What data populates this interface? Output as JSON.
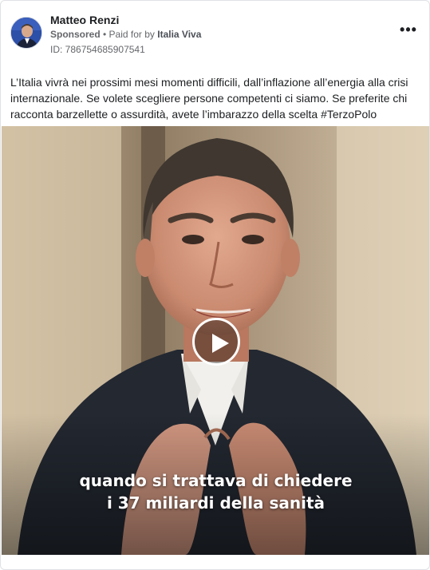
{
  "post": {
    "author": "Matteo Renzi",
    "sponsored_label": "Sponsored",
    "separator": " • ",
    "paid_for_prefix": "Paid for by ",
    "paid_for_by": "Italia Viva",
    "ad_id": "ID: 786754685907541",
    "more_icon": "more-horizontal-icon",
    "more_label": "•••",
    "text": "L’Italia vivrà nei prossimi mesi momenti difficili, dall’inflazione all’energia alla crisi internazionale. Se volete scegliere persone competenti ci siamo. Se preferite chi racconta barzellette o assurdità, avete l’imbarazzo della scelta #TerzoPolo"
  },
  "video": {
    "play_icon": "play-icon",
    "caption_line1": "quando si trattava di chiedere",
    "caption_line2": "i 37 miliardi della sanità"
  },
  "colors": {
    "text_primary": "#1c1e21",
    "text_secondary": "#65676b",
    "border": "#dfe1e5"
  }
}
